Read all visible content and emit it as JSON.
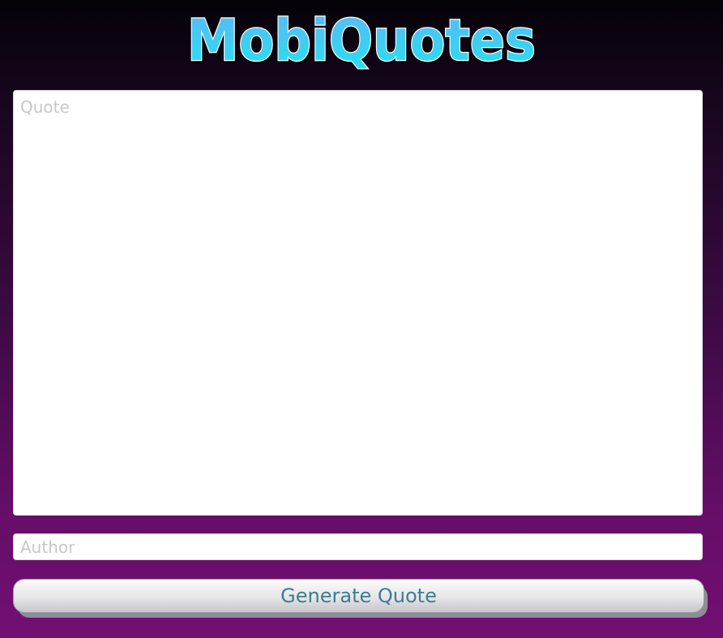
{
  "header": {
    "logo_text": "MobiQuotes"
  },
  "form": {
    "quote_placeholder": "Quote",
    "author_placeholder": "Author",
    "generate_label": "Generate Quote"
  },
  "colors": {
    "background_top": "#050208",
    "background_bottom": "#720f73",
    "logo_fill": "#35d9f0",
    "logo_outline": "#ffffff",
    "button_text": "#3d7d93"
  }
}
